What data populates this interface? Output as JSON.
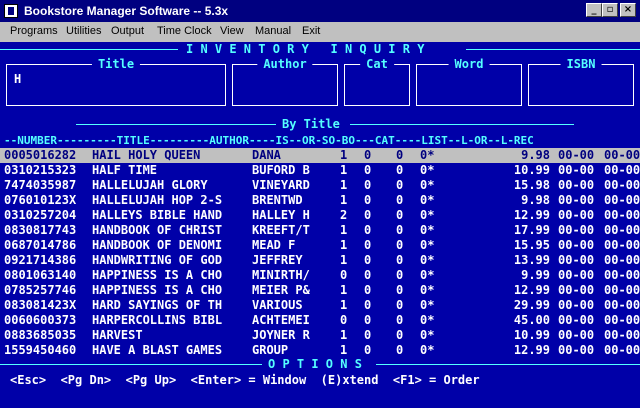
{
  "window": {
    "title": "Bookstore Manager Software -- 5.3x"
  },
  "menu": [
    "Programs",
    "Utilities",
    "Output",
    "Time Clock",
    "View",
    "Manual",
    "Exit"
  ],
  "inquiry": {
    "heading": "I N V E N T O R Y   I N Q U I R Y",
    "fields": {
      "title": "Title",
      "author": "Author",
      "cat": "Cat",
      "word": "Word",
      "isbn": "ISBN"
    },
    "title_value": "H"
  },
  "list": {
    "sort_label": "By Title",
    "header": "--NUMBER---------TITLE---------AUTHOR----IS--OR-SO-BO---CAT----LIST--L-OR--L-REC",
    "rows": [
      {
        "number": "0005016282",
        "title": "HAIL HOLY QUEEN",
        "author": "DANA",
        "is": "1",
        "or": "0",
        "so": "0",
        "bo": "0*",
        "list": "9.98",
        "lor": "00-00",
        "lrec": "00-00"
      },
      {
        "number": "0310215323",
        "title": "HALF TIME",
        "author": "BUFORD B",
        "is": "1",
        "or": "0",
        "so": "0",
        "bo": "0*",
        "list": "10.99",
        "lor": "00-00",
        "lrec": "00-00"
      },
      {
        "number": "7474035987",
        "title": "HALLELUJAH GLORY",
        "author": "VINEYARD",
        "is": "1",
        "or": "0",
        "so": "0",
        "bo": "0*",
        "list": "15.98",
        "lor": "00-00",
        "lrec": "00-00"
      },
      {
        "number": "076010123X",
        "title": "HALLELUJAH HOP 2-S",
        "author": "BRENTWD",
        "is": "1",
        "or": "0",
        "so": "0",
        "bo": "0*",
        "list": "9.98",
        "lor": "00-00",
        "lrec": "00-00"
      },
      {
        "number": "0310257204",
        "title": "HALLEYS BIBLE HAND",
        "author": "HALLEY H",
        "is": "2",
        "or": "0",
        "so": "0",
        "bo": "0*",
        "list": "12.99",
        "lor": "00-00",
        "lrec": "00-00"
      },
      {
        "number": "0830817743",
        "title": "HANDBOOK OF CHRIST",
        "author": "KREEFT/T",
        "is": "1",
        "or": "0",
        "so": "0",
        "bo": "0*",
        "list": "17.99",
        "lor": "00-00",
        "lrec": "00-00"
      },
      {
        "number": "0687014786",
        "title": "HANDBOOK OF DENOMI",
        "author": "MEAD F",
        "is": "1",
        "or": "0",
        "so": "0",
        "bo": "0*",
        "list": "15.95",
        "lor": "00-00",
        "lrec": "00-00"
      },
      {
        "number": "0921714386",
        "title": "HANDWRITING OF GOD",
        "author": "JEFFREY",
        "is": "1",
        "or": "0",
        "so": "0",
        "bo": "0*",
        "list": "13.99",
        "lor": "00-00",
        "lrec": "00-00"
      },
      {
        "number": "0801063140",
        "title": "HAPPINESS IS A CHO",
        "author": "MINIRTH/",
        "is": "0",
        "or": "0",
        "so": "0",
        "bo": "0*",
        "list": "9.99",
        "lor": "00-00",
        "lrec": "00-00"
      },
      {
        "number": "0785257746",
        "title": "HAPPINESS IS A CHO",
        "author": "MEIER P&",
        "is": "1",
        "or": "0",
        "so": "0",
        "bo": "0*",
        "list": "12.99",
        "lor": "00-00",
        "lrec": "00-00"
      },
      {
        "number": "083081423X",
        "title": "HARD SAYINGS OF TH",
        "author": "VARIOUS",
        "is": "1",
        "or": "0",
        "so": "0",
        "bo": "0*",
        "list": "29.99",
        "lor": "00-00",
        "lrec": "00-00"
      },
      {
        "number": "0060600373",
        "title": "HARPERCOLLINS BIBL",
        "author": "ACHTEMEI",
        "is": "0",
        "or": "0",
        "so": "0",
        "bo": "0*",
        "list": "45.00",
        "lor": "00-00",
        "lrec": "00-00"
      },
      {
        "number": "0883685035",
        "title": "HARVEST",
        "author": "JOYNER R",
        "is": "1",
        "or": "0",
        "so": "0",
        "bo": "0*",
        "list": "10.99",
        "lor": "00-00",
        "lrec": "00-00"
      },
      {
        "number": "1559450460",
        "title": "HAVE A BLAST GAMES",
        "author": "GROUP",
        "is": "1",
        "or": "0",
        "so": "0",
        "bo": "0*",
        "list": "12.99",
        "lor": "00-00",
        "lrec": "00-00"
      }
    ]
  },
  "options": {
    "heading": "O P T I O N S",
    "keys": "<Esc>  <Pg Dn>  <Pg Up>  <Enter> = Window  (E)xtend  <F1> = Order"
  },
  "colors": {
    "console_bg": "#0000a8",
    "accent": "#55ffff",
    "titlebar": "#000080",
    "selected_row": "#c0c0c0"
  }
}
